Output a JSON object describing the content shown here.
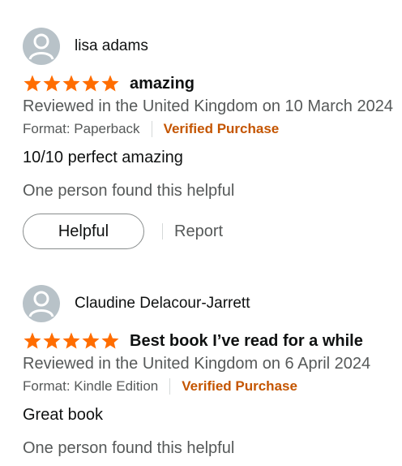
{
  "reviews": [
    {
      "reviewer_name": "lisa adams",
      "rating": 5,
      "title": "amazing",
      "date_text": "Reviewed in the United Kingdom on 10 March 2024",
      "format": "Format: Paperback",
      "verified": "Verified Purchase",
      "body": "10/10 perfect amazing",
      "helpful_text": "One person found this helpful",
      "helpful_label": "Helpful",
      "report_label": "Report"
    },
    {
      "reviewer_name": "Claudine Delacour-Jarrett",
      "rating": 5,
      "title": "Best book I’ve read for a while",
      "date_text": "Reviewed in the United Kingdom on 6 April 2024",
      "format": "Format: Kindle Edition",
      "verified": "Verified Purchase",
      "body": "Great book",
      "helpful_text": "One person found this helpful"
    }
  ],
  "colors": {
    "star": "#ff6d00",
    "verified": "#c45500",
    "muted": "#565959",
    "avatar_bg": "#b8c2c8"
  },
  "icons": {
    "avatar": "user-avatar-icon",
    "star": "star-icon"
  }
}
